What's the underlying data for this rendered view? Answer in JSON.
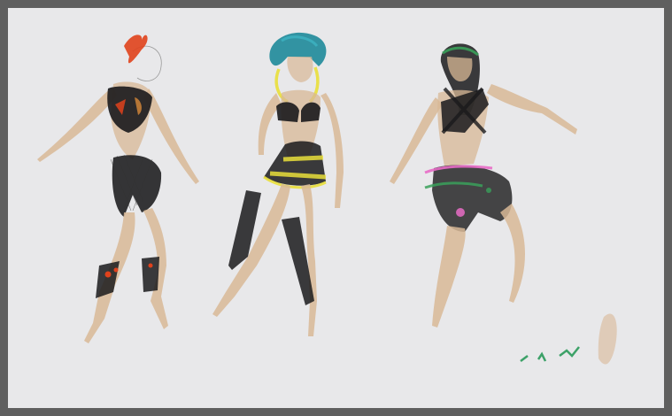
{
  "artwork": {
    "subject": "costume sketch",
    "figures": [
      {
        "id": "left",
        "accent": "#e0421c"
      },
      {
        "id": "center",
        "accent": "#e9df3a"
      },
      {
        "id": "right",
        "accent": "#e86cc6"
      }
    ],
    "palette": {
      "skin": "#d8b896",
      "black": "#1a1a1c",
      "teal": "#1e8a9a",
      "yellow": "#e9df3a",
      "green": "#3aa05a",
      "paper": "#e8e8ea",
      "mount": "#5f5f5f"
    }
  }
}
